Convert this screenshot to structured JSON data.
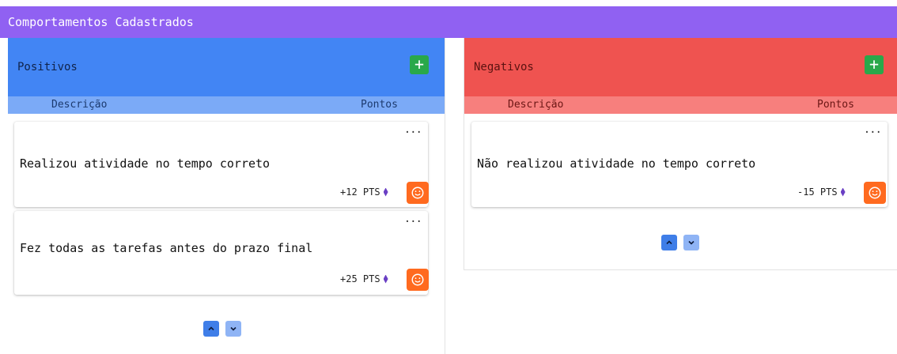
{
  "header": {
    "title": "Comportamentos Cadastrados"
  },
  "positive": {
    "title": "Positivos",
    "add_icon": "plus-icon",
    "columns": {
      "description": "Descrição",
      "points": "Pontos"
    },
    "items": [
      {
        "description": "Realizou atividade no tempo correto",
        "points": "+12 PTS"
      },
      {
        "description": "Fez todas as tarefas antes do prazo final",
        "points": "+25 PTS"
      }
    ]
  },
  "negative": {
    "title": "Negativos",
    "add_icon": "plus-icon",
    "columns": {
      "description": "Descrição",
      "points": "Pontos"
    },
    "items": [
      {
        "description": "Não realizou atividade no tempo correto",
        "points": "-15 PTS"
      }
    ]
  },
  "menu_glyph": "...",
  "add_glyph": "+",
  "colors": {
    "header": "#9061f2",
    "positive": "#4285f4",
    "negative": "#ef5350",
    "add_button": "#29a84a",
    "smile_button": "#ff6a1f"
  }
}
